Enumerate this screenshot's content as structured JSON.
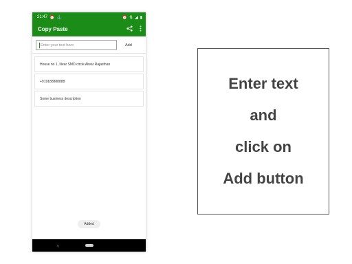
{
  "status_bar": {
    "time": "21:47",
    "left_icons": [
      "alarm-icon",
      "usb-icon"
    ],
    "right_icons": [
      "alarm-icon",
      "data-icon",
      "signal-icon",
      "battery-icon"
    ]
  },
  "app_bar": {
    "title": "Copy Paste",
    "actions": [
      "share-icon",
      "more-vert-icon"
    ]
  },
  "input": {
    "placeholder": "Enter your text here",
    "value": ""
  },
  "add_button": {
    "label": "Add"
  },
  "items": [
    {
      "text": "House no 1, Near SMD circle Alwar Rajasthan"
    },
    {
      "text": "+919188888888"
    },
    {
      "text": "Some business description"
    }
  ],
  "toast": {
    "text": "Added"
  },
  "callout": {
    "lines": [
      "Enter text",
      "and",
      "click on",
      "Add button"
    ]
  },
  "colors": {
    "primary": "#1a8c17",
    "text": "#444444"
  }
}
